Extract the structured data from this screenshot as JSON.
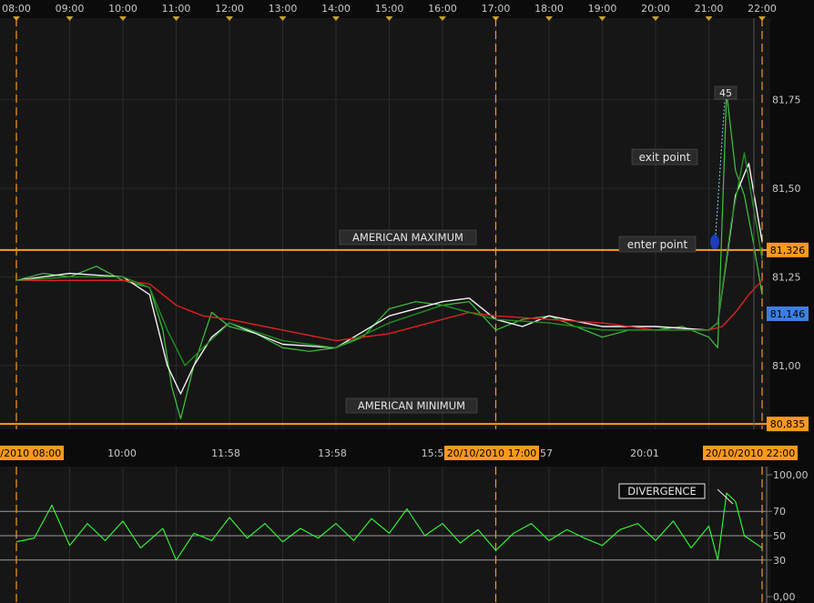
{
  "colors": {
    "background": "#0b0b0b",
    "panel": "#161616",
    "grid": "#2a2a2a",
    "axis_text": "#c8c8c8",
    "orange": "#ff9a1a",
    "price_green": "#3ec43e",
    "ma_white": "#f2f2f2",
    "ma_red": "#e02020",
    "ma_darkgreen": "#1f8f1f",
    "osc_green": "#33ff33",
    "blue_badge": "#3d7fe0"
  },
  "chart_data": [
    {
      "type": "line",
      "name": "price-panel",
      "time_axis": [
        "08:00",
        "09:00",
        "10:00",
        "11:00",
        "12:00",
        "13:00",
        "14:00",
        "15:00",
        "16:00",
        "17:00",
        "18:00",
        "19:00",
        "20:00",
        "21:00",
        "22:00"
      ],
      "bottom_axis": [
        "20/10/2010 08:00",
        "10:00",
        "11:58",
        "13:58",
        "15:5",
        "20/10/2010 17:00",
        "57",
        "20:01",
        "20/10/2010 22:00"
      ],
      "y_ticks": [
        "81,75",
        "81,50",
        "81,25",
        "81,00"
      ],
      "ylim": [
        80.82,
        81.98
      ],
      "price_badges": [
        {
          "label": "81,326",
          "value": 81.326,
          "color": "orange"
        },
        {
          "label": "81,146",
          "value": 81.146,
          "color": "blue"
        },
        {
          "label": "80,835",
          "value": 80.835,
          "color": "orange"
        }
      ],
      "horizontal_levels": [
        81.326,
        80.835
      ],
      "session_markers": [
        "08:00",
        "17:00",
        "22:00"
      ],
      "annotations": {
        "american_maximum": "AMERICAN MAXIMUM",
        "american_minimum": "AMERICAN MINIMUM",
        "exit_point": "exit point",
        "enter_point": "enter point",
        "spike_label": "45"
      },
      "series": [
        {
          "role": "price",
          "color": "price_green",
          "x": [
            "08:00",
            "08:30",
            "09:00",
            "09:30",
            "10:00",
            "10:30",
            "10:45",
            "10:55",
            "11:05",
            "11:20",
            "11:40",
            "12:00",
            "12:30",
            "13:00",
            "13:30",
            "14:00",
            "14:30",
            "15:00",
            "15:30",
            "16:00",
            "16:30",
            "17:00",
            "17:30",
            "18:00",
            "18:30",
            "19:00",
            "19:30",
            "20:00",
            "20:30",
            "21:00",
            "21:10",
            "21:20",
            "21:30",
            "21:40",
            "21:50",
            "22:00"
          ],
          "y": [
            81.24,
            81.26,
            81.25,
            81.28,
            81.24,
            81.22,
            81.1,
            80.94,
            80.85,
            81.0,
            81.15,
            81.11,
            81.09,
            81.05,
            81.04,
            81.05,
            81.08,
            81.16,
            81.18,
            81.17,
            81.18,
            81.1,
            81.13,
            81.14,
            81.11,
            81.08,
            81.1,
            81.1,
            81.11,
            81.08,
            81.05,
            81.77,
            81.55,
            81.48,
            81.35,
            81.2
          ]
        },
        {
          "role": "moving-average-fast",
          "color": "ma_white",
          "x": [
            "08:00",
            "09:00",
            "10:00",
            "10:30",
            "10:50",
            "11:05",
            "11:20",
            "11:40",
            "12:00",
            "13:00",
            "14:00",
            "15:00",
            "16:00",
            "16:30",
            "17:00",
            "17:30",
            "18:00",
            "19:00",
            "20:00",
            "21:00",
            "21:10",
            "21:30",
            "21:45",
            "22:00"
          ],
          "y": [
            81.24,
            81.26,
            81.25,
            81.2,
            81.0,
            80.92,
            81.0,
            81.08,
            81.12,
            81.06,
            81.05,
            81.14,
            81.18,
            81.19,
            81.13,
            81.11,
            81.14,
            81.11,
            81.11,
            81.1,
            81.12,
            81.48,
            81.57,
            81.35
          ]
        },
        {
          "role": "moving-average-slow",
          "color": "ma_red",
          "x": [
            "08:00",
            "09:00",
            "10:00",
            "10:30",
            "11:00",
            "11:30",
            "12:00",
            "13:00",
            "14:00",
            "15:00",
            "16:00",
            "16:30",
            "17:00",
            "18:00",
            "19:00",
            "20:00",
            "21:00",
            "21:15",
            "21:30",
            "21:45",
            "22:00"
          ],
          "y": [
            81.24,
            81.24,
            81.24,
            81.23,
            81.17,
            81.14,
            81.13,
            81.1,
            81.07,
            81.09,
            81.13,
            81.15,
            81.14,
            81.13,
            81.12,
            81.1,
            81.1,
            81.11,
            81.15,
            81.2,
            81.24
          ]
        },
        {
          "role": "moving-average-mid",
          "color": "ma_darkgreen",
          "x": [
            "08:00",
            "09:00",
            "10:00",
            "10:30",
            "10:50",
            "11:10",
            "11:30",
            "12:00",
            "13:00",
            "14:00",
            "15:00",
            "16:00",
            "17:00",
            "18:00",
            "19:00",
            "20:00",
            "21:00",
            "21:10",
            "21:25",
            "21:40",
            "22:00"
          ],
          "y": [
            81.24,
            81.25,
            81.25,
            81.22,
            81.1,
            81.0,
            81.05,
            81.12,
            81.07,
            81.05,
            81.12,
            81.17,
            81.13,
            81.12,
            81.1,
            81.1,
            81.1,
            81.12,
            81.4,
            81.6,
            81.3
          ]
        }
      ]
    },
    {
      "type": "line",
      "name": "oscillator-panel",
      "y_ticks": [
        "100,00",
        "70",
        "50",
        "30",
        "0,00"
      ],
      "ylim": [
        0,
        100
      ],
      "reference_levels": [
        70,
        50,
        30
      ],
      "annotation": "DIVERGENCE",
      "series": [
        {
          "role": "oscillator",
          "color": "osc_green",
          "x": [
            "08:00",
            "08:20",
            "08:40",
            "09:00",
            "09:20",
            "09:40",
            "10:00",
            "10:20",
            "10:45",
            "11:00",
            "11:20",
            "11:40",
            "12:00",
            "12:20",
            "12:40",
            "13:00",
            "13:20",
            "13:40",
            "14:00",
            "14:20",
            "14:40",
            "15:00",
            "15:20",
            "15:40",
            "16:00",
            "16:20",
            "16:40",
            "17:00",
            "17:20",
            "17:40",
            "18:00",
            "18:20",
            "18:40",
            "19:00",
            "19:20",
            "19:40",
            "20:00",
            "20:20",
            "20:40",
            "21:00",
            "21:10",
            "21:20",
            "21:30",
            "21:40",
            "22:00"
          ],
          "y": [
            45,
            48,
            75,
            42,
            60,
            46,
            62,
            40,
            56,
            30,
            52,
            46,
            65,
            48,
            60,
            45,
            56,
            48,
            60,
            46,
            64,
            52,
            72,
            50,
            60,
            44,
            55,
            38,
            52,
            60,
            46,
            55,
            48,
            42,
            55,
            60,
            46,
            62,
            40,
            58,
            30,
            85,
            78,
            50,
            40
          ]
        }
      ]
    }
  ]
}
